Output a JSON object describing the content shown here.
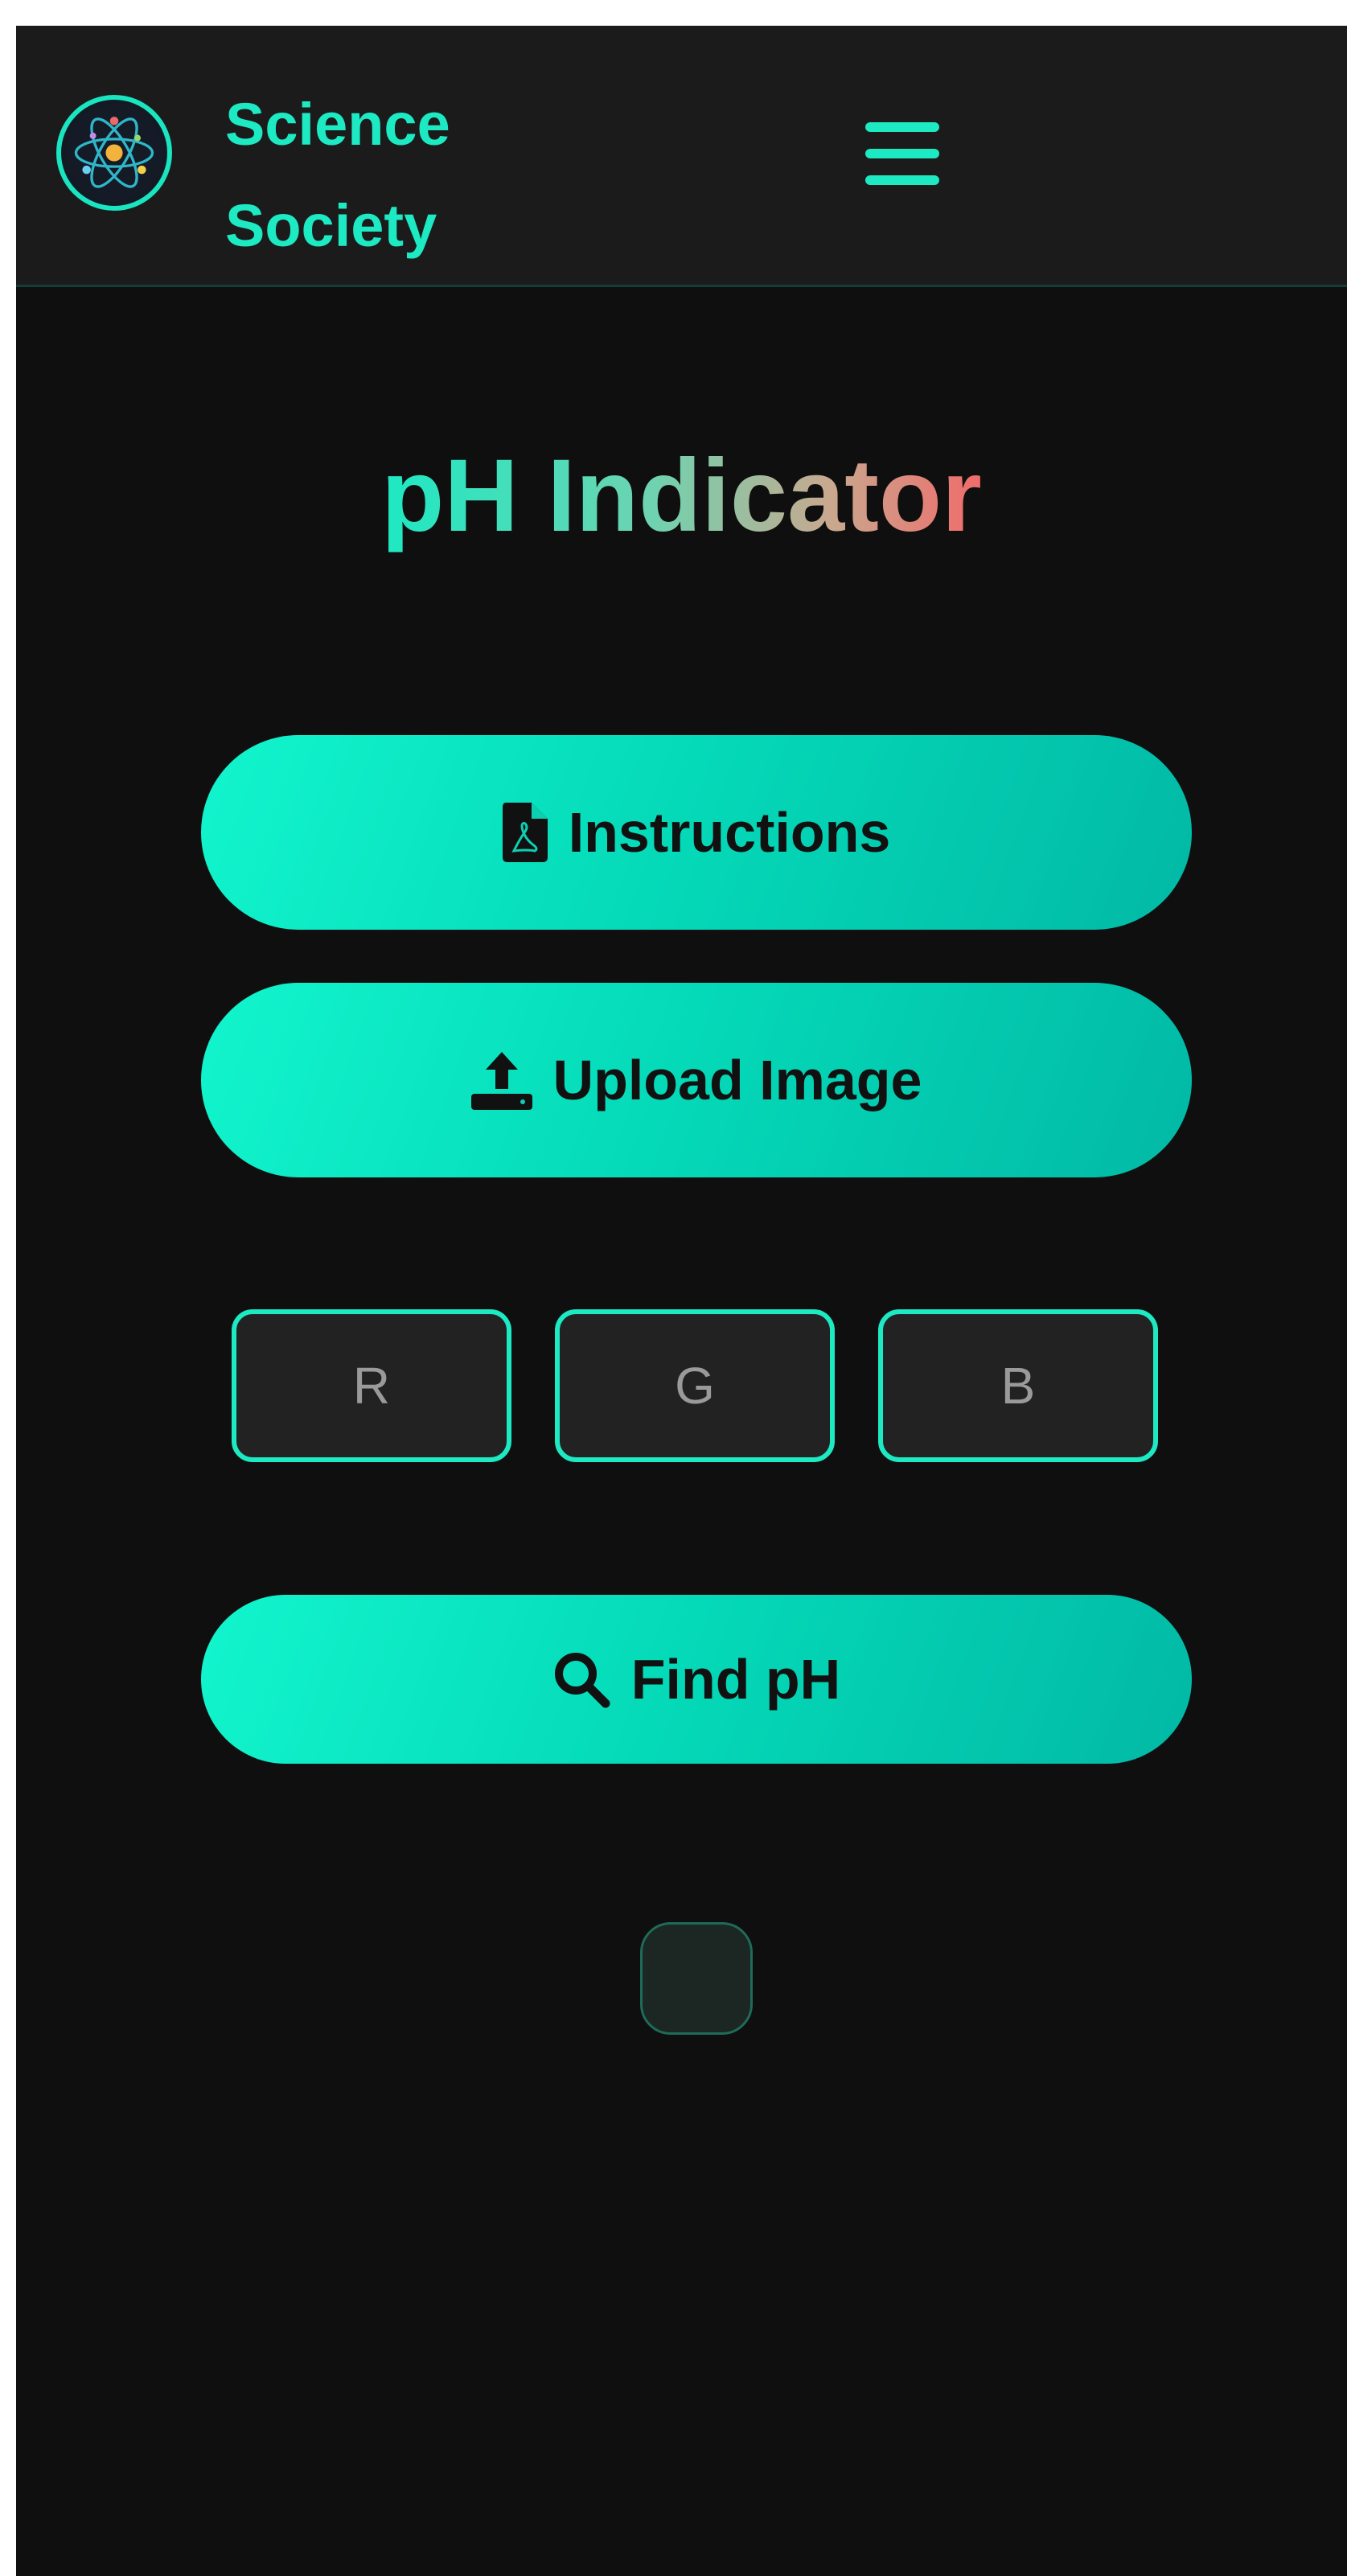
{
  "header": {
    "brand_line1": "Science",
    "brand_line2": "Society",
    "logo_icon": "atom-logo-icon",
    "menu_icon": "hamburger-menu-icon"
  },
  "main": {
    "title": "pH Indicator",
    "instructions_button": {
      "label": "Instructions",
      "icon": "pdf-file-icon"
    },
    "upload_button": {
      "label": "Upload Image",
      "icon": "upload-icon"
    },
    "rgb_inputs": {
      "r_placeholder": "R",
      "g_placeholder": "G",
      "b_placeholder": "B",
      "r_value": "",
      "g_value": "",
      "b_value": ""
    },
    "find_button": {
      "label": "Find pH",
      "icon": "search-icon"
    }
  },
  "colors": {
    "accent": "#1de9c3",
    "background": "#0f0f0f",
    "header_background": "#1b1b1b",
    "title_gradient_start": "#1de9c3",
    "title_gradient_end": "#f06b6b"
  }
}
